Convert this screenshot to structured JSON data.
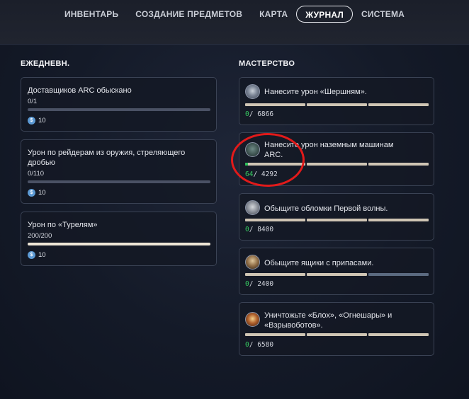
{
  "nav": {
    "tabs": [
      {
        "label": "ИНВЕНТАРЬ",
        "active": false
      },
      {
        "label": "СОЗДАНИЕ ПРЕДМЕТОВ",
        "active": false
      },
      {
        "label": "КАРТА",
        "active": false
      },
      {
        "label": "ЖУРНАЛ",
        "active": true
      },
      {
        "label": "СИСТЕМА",
        "active": false
      }
    ]
  },
  "daily": {
    "title": "ЕЖЕДНЕВН.",
    "items": [
      {
        "label_lines": [
          "Доставщиков ARC обыскано"
        ],
        "progress_text": "0/1",
        "progress": 0.0,
        "reward": "10"
      },
      {
        "label_lines": [
          "Урон по рейдерам из оружия, стреляющего",
          "дробью"
        ],
        "progress_text": "0/110",
        "progress": 0.0,
        "reward": "10"
      },
      {
        "label_lines": [
          "Урон по «Турелям»"
        ],
        "progress_text": "200/200",
        "progress": 1.0,
        "reward": "10"
      }
    ]
  },
  "mastery": {
    "title": "МАСТЕРСТВО",
    "items": [
      {
        "label_lines": [
          "Нанесите урон «Шершням»."
        ],
        "current": "0",
        "total": "6866",
        "sep": "/",
        "avatar": "hornet-drone-icon",
        "green_fraction": 0.0
      },
      {
        "label_lines": [
          "Нанесите урон наземным машинам",
          "ARC."
        ],
        "current": "64",
        "total": "4292",
        "sep": "/",
        "avatar": "ground-machine-icon",
        "green_fraction": 0.015
      },
      {
        "label_lines": [
          "Обыщите обломки Первой волны."
        ],
        "current": "0",
        "total": "8400",
        "sep": "/",
        "avatar": "wreckage-icon",
        "green_fraction": 0.0
      },
      {
        "label_lines": [
          "Обыщите ящики с припасами."
        ],
        "current": "0",
        "total": "2400",
        "sep": "/",
        "avatar": "supply-crate-icon",
        "green_fraction": 0.0
      },
      {
        "label_lines": [
          "Уничтожьте «Блох», «Огнешары» и",
          "«Взрывоботов»."
        ],
        "current": "0",
        "total": "6580",
        "sep": "/",
        "avatar": "explosion-icon",
        "green_fraction": 0.0
      }
    ]
  },
  "colors": {
    "accent_green": "#36c961",
    "highlight_circle": "#e21a1a",
    "coin": "#5c9ad4"
  }
}
